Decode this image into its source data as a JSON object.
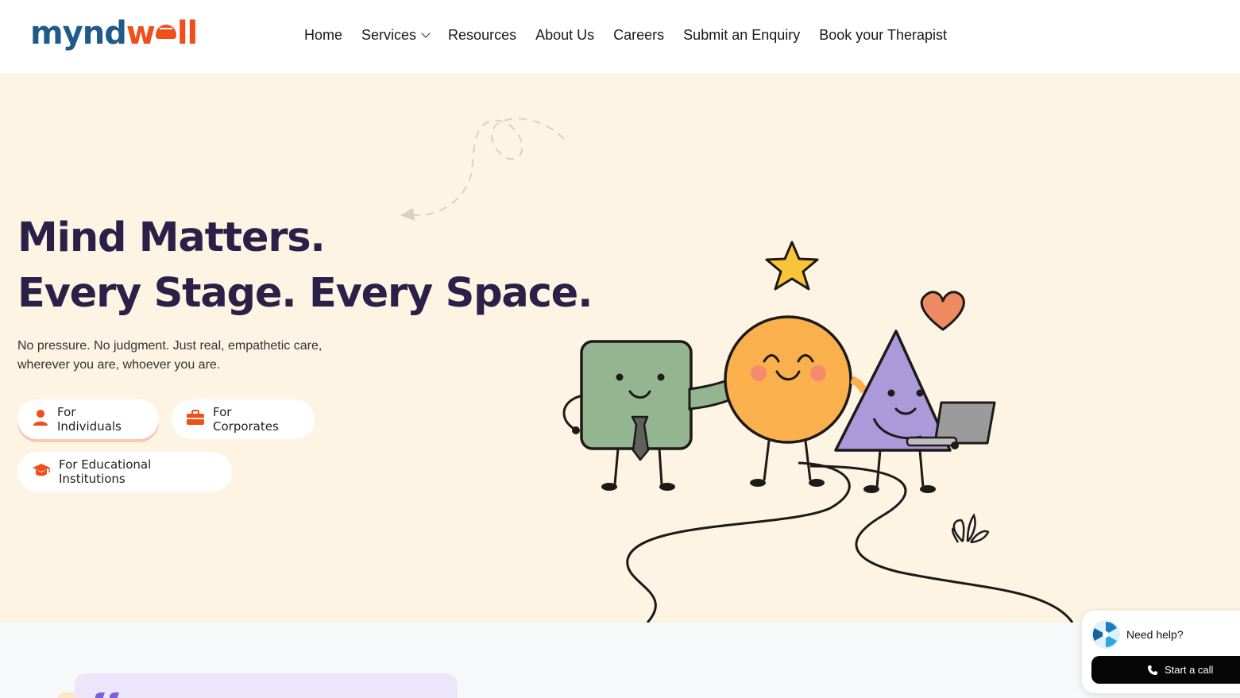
{
  "brand": {
    "logo_part1": "mynd",
    "logo_part2": "w",
    "logo_part3": "ll"
  },
  "nav": {
    "items": [
      {
        "label": "Home"
      },
      {
        "label": "Services",
        "has_dropdown": true
      },
      {
        "label": "Resources"
      },
      {
        "label": "About Us"
      },
      {
        "label": "Careers"
      },
      {
        "label": "Submit an Enquiry"
      },
      {
        "label": "Book your Therapist"
      }
    ]
  },
  "hero": {
    "title_line1": "Mind Matters.",
    "title_line2": "Every Stage. Every Space.",
    "subtitle_line1": "No pressure. No judgment. Just real, empathetic care,",
    "subtitle_line2": "wherever you are, whoever you are.",
    "buttons": {
      "individuals": {
        "label": "For Individuals",
        "icon": "person-icon"
      },
      "corporates": {
        "label": "For Corporates",
        "icon": "briefcase-icon"
      },
      "education": {
        "label": "For Educational Institutions",
        "icon": "graduation-cap-icon"
      }
    }
  },
  "help_widget": {
    "prompt": "Need help?",
    "button_label": "Start a call",
    "icon": "phone-icon"
  },
  "colors": {
    "accent": "#f04e1a",
    "brand_blue": "#1f5a8a",
    "heading": "#2a2048",
    "hero_bg": "#fdf4e3"
  }
}
